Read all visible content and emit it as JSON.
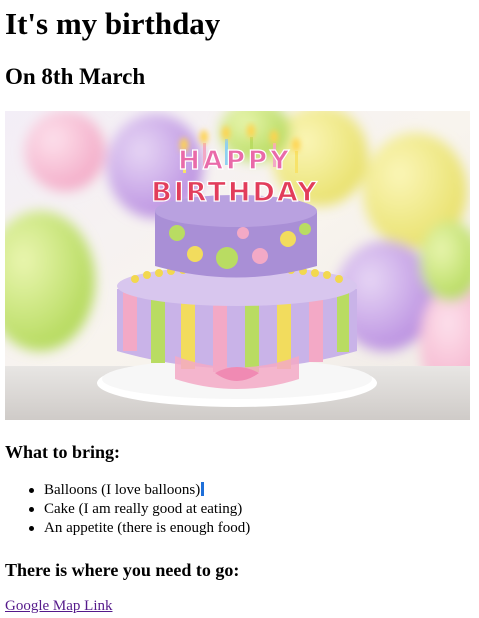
{
  "page": {
    "title": "It's my birthday",
    "subtitle": "On 8th March"
  },
  "hero": {
    "cake_topper_line1": "HAPPY",
    "cake_topper_line2": "BIRTHDAY",
    "colors": {
      "cake_top": "#a98fd6",
      "cake_bottom": "#c9b3e8",
      "stripe_yellow": "#f2dc5d",
      "stripe_pink": "#f3a9c6",
      "dot_green": "#b9dc62",
      "plate": "#f7f7f7"
    }
  },
  "bring": {
    "heading": "What to bring:",
    "items": [
      "Balloons (I love balloons)",
      "Cake (I am really good at eating)",
      "An appetite (there is enough food)"
    ]
  },
  "directions": {
    "heading": "There is where you need to go:",
    "link_label": "Google Map Link"
  }
}
